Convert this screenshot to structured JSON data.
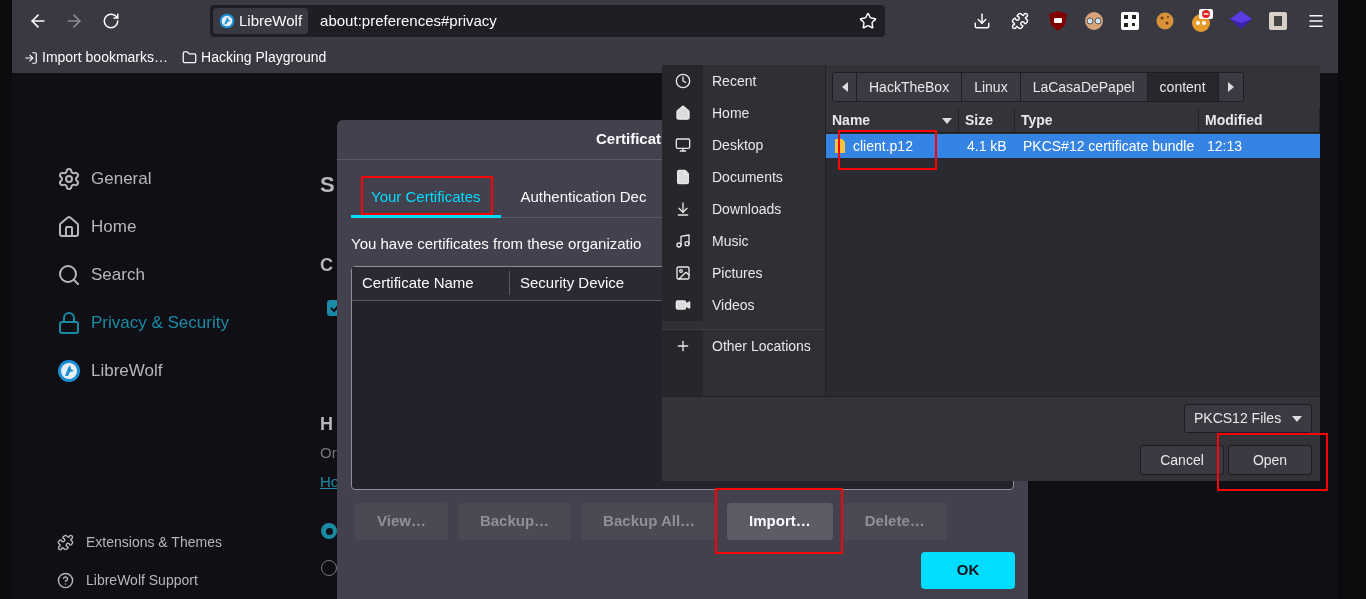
{
  "url_bar": {
    "identity": "LibreWolf",
    "url": "about:preferences#privacy"
  },
  "bookmarks": [
    {
      "kind": "import",
      "label": "Import bookmarks…"
    },
    {
      "kind": "folder",
      "label": "Hacking Playground"
    }
  ],
  "sidebar": {
    "items": [
      {
        "kind": "general",
        "label": "General",
        "selected": false
      },
      {
        "kind": "home",
        "label": "Home",
        "selected": false
      },
      {
        "kind": "search",
        "label": "Search",
        "selected": false
      },
      {
        "kind": "privacy",
        "label": "Privacy & Security",
        "selected": true
      },
      {
        "kind": "librewolf",
        "label": "LibreWolf",
        "selected": false
      }
    ],
    "footer": [
      {
        "kind": "extensions",
        "label": "Extensions & Themes"
      },
      {
        "kind": "support",
        "label": "LibreWolf Support"
      }
    ]
  },
  "page": {
    "heading": "S",
    "section_heading": "C",
    "checkbox": {
      "checked": true
    },
    "section2_heading": "H",
    "text": "Or",
    "link": "Ho",
    "radios": [
      {
        "selected": true
      },
      {
        "selected": false
      }
    ]
  },
  "certificate_dialog": {
    "title": "Certificat",
    "tabs": [
      {
        "label": "Your Certificates",
        "selected": true,
        "highlighted": true
      },
      {
        "label": "Authentication Dec",
        "selected": false,
        "highlighted": false
      }
    ],
    "description": "You have certificates from these organizatio",
    "columns": [
      "Certificate Name",
      "Security Device"
    ],
    "buttons": [
      {
        "label": "View…",
        "disabled": true,
        "highlighted": false
      },
      {
        "label": "Backup…",
        "disabled": true,
        "highlighted": false
      },
      {
        "label": "Backup All…",
        "disabled": true,
        "highlighted": false
      },
      {
        "label": "Import…",
        "disabled": false,
        "highlighted": true
      },
      {
        "label": "Delete…",
        "disabled": true,
        "highlighted": false
      }
    ],
    "ok": "OK"
  },
  "file_chooser": {
    "places": [
      {
        "kind": "recent",
        "label": "Recent"
      },
      {
        "kind": "home",
        "label": "Home"
      },
      {
        "kind": "desktop",
        "label": "Desktop"
      },
      {
        "kind": "documents",
        "label": "Documents"
      },
      {
        "kind": "downloads",
        "label": "Downloads"
      },
      {
        "kind": "music",
        "label": "Music"
      },
      {
        "kind": "pictures",
        "label": "Pictures"
      },
      {
        "kind": "videos",
        "label": "Videos"
      },
      {
        "kind": "other",
        "label": "Other Locations"
      }
    ],
    "path": [
      {
        "label": "HackTheBox",
        "selected": false
      },
      {
        "label": "Linux",
        "selected": false
      },
      {
        "label": "LaCasaDePapel",
        "selected": false
      },
      {
        "label": "content",
        "selected": true
      }
    ],
    "columns": [
      "Name",
      "Size",
      "Type",
      "Modified"
    ],
    "files": [
      {
        "name": "client.p12",
        "size": "4.1 kB",
        "type": "PKCS#12 certificate bundle",
        "modified": "12:13",
        "selected": true,
        "highlighted": true
      }
    ],
    "filter": "PKCS12 Files",
    "buttons": [
      {
        "label": "Cancel",
        "highlighted": false
      },
      {
        "label": "Open",
        "highlighted": true
      }
    ]
  }
}
